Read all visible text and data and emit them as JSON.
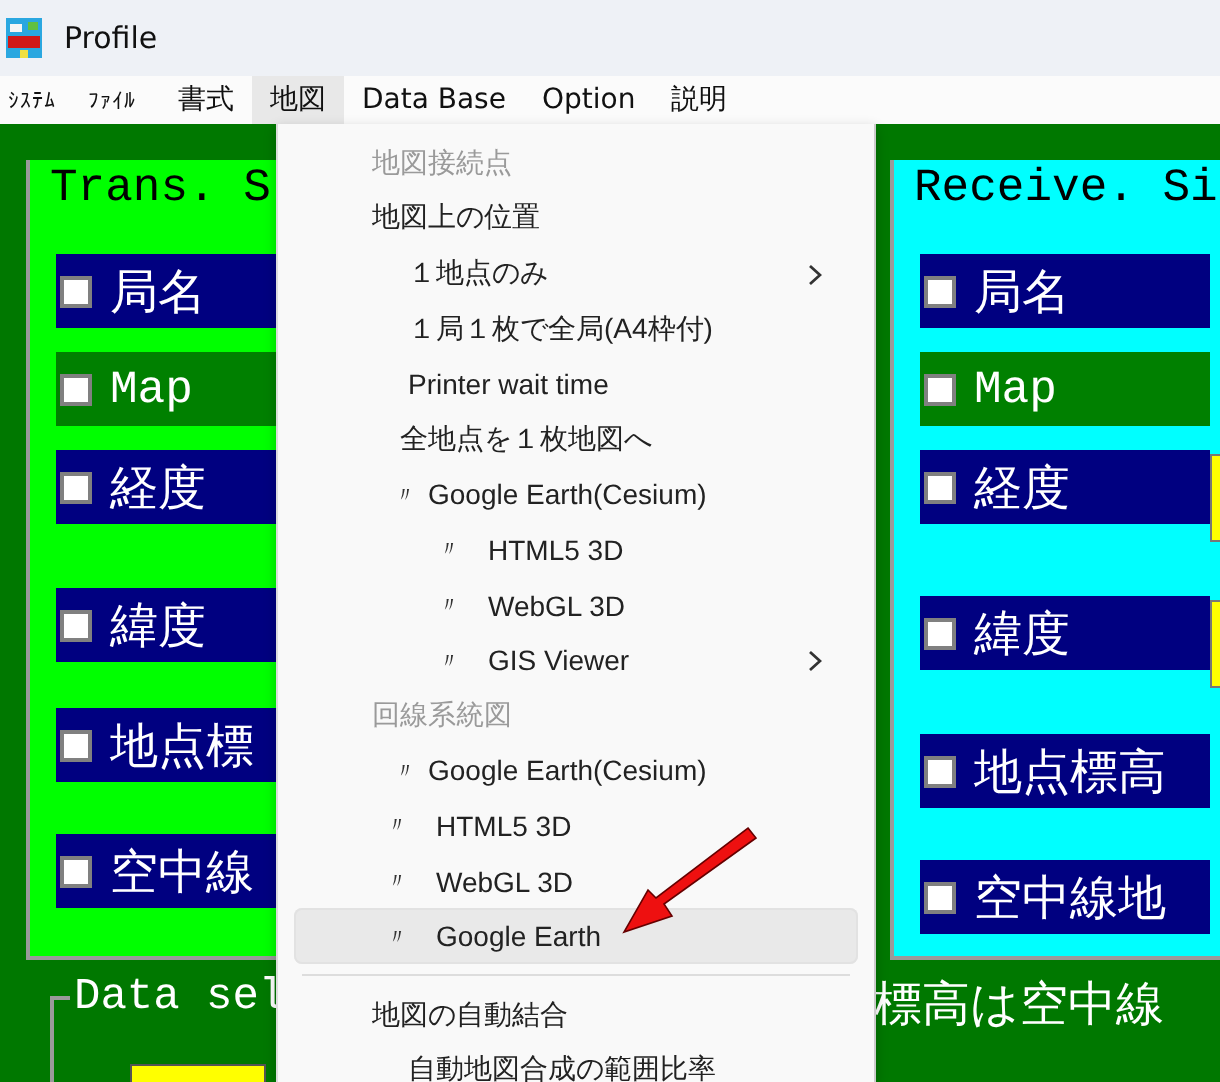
{
  "window": {
    "title": "Profile"
  },
  "menubar": [
    {
      "label": "ｼｽﾃﾑ",
      "selected": false,
      "kind": "small"
    },
    {
      "label": "ﾌｧｲﾙ",
      "selected": false,
      "kind": "small"
    },
    {
      "label": "書式",
      "selected": false,
      "kind": "normal"
    },
    {
      "label": "地図",
      "selected": true,
      "kind": "normal"
    },
    {
      "label": "Data Base",
      "selected": false,
      "kind": "normal"
    },
    {
      "label": "Option",
      "selected": false,
      "kind": "normal"
    },
    {
      "label": "説明",
      "selected": false,
      "kind": "normal"
    }
  ],
  "trans_side": {
    "title": "Trans. S",
    "strips": [
      {
        "label": "局名",
        "checked": false,
        "color": "#000080",
        "field": false
      },
      {
        "label": "Map",
        "checked": false,
        "color": "#008000",
        "field": false
      },
      {
        "label": "経度",
        "checked": false,
        "color": "#000080",
        "field": false
      },
      {
        "label": "緯度",
        "checked": false,
        "color": "#000080",
        "field": false
      },
      {
        "label": "地点標",
        "checked": false,
        "color": "#000080",
        "field": false
      },
      {
        "label": "空中線",
        "checked": false,
        "color": "#000080",
        "field": false
      }
    ]
  },
  "receive_side": {
    "title": "Receive. Si",
    "strips": [
      {
        "label": "局名",
        "checked": false,
        "color": "#000080",
        "field": false
      },
      {
        "label": "Map",
        "checked": false,
        "color": "#008000",
        "field": false
      },
      {
        "label": "経度",
        "checked": false,
        "color": "#000080",
        "field": true
      },
      {
        "label": "緯度",
        "checked": false,
        "color": "#000080",
        "field": true
      },
      {
        "label": "地点標高",
        "checked": false,
        "color": "#000080",
        "field": false
      },
      {
        "label": "空中線地",
        "checked": false,
        "color": "#000080",
        "field": false
      }
    ]
  },
  "data_select": {
    "title": "Data sel",
    "field": true
  },
  "note": "標高は空中線",
  "map_menu": [
    {
      "kind": "heading",
      "label": "地図接続点",
      "disabled": true,
      "submenu": false
    },
    {
      "kind": "item",
      "label": "地図上の位置",
      "disabled": false,
      "submenu": false,
      "selected": false
    },
    {
      "kind": "option",
      "label": "１地点のみ",
      "disabled": false,
      "submenu": true,
      "selected": false
    },
    {
      "kind": "option",
      "label": "１局１枚で全局(A4枠付)",
      "disabled": false,
      "submenu": false,
      "selected": false
    },
    {
      "kind": "option",
      "label": "Printer wait time",
      "disabled": false,
      "submenu": false,
      "selected": false
    },
    {
      "kind": "option2",
      "label": "全地点を１枚地図へ",
      "disabled": false,
      "submenu": false,
      "selected": false
    },
    {
      "kind": "link",
      "mark": "〃",
      "label": "Google Earth(Cesium)",
      "disabled": false,
      "submenu": false,
      "selected": false
    },
    {
      "kind": "sublink",
      "mark": "〃",
      "label": "HTML5 3D",
      "disabled": false,
      "submenu": false,
      "selected": false
    },
    {
      "kind": "sublink",
      "mark": "〃",
      "label": "WebGL 3D",
      "disabled": false,
      "submenu": false,
      "selected": false
    },
    {
      "kind": "sublink",
      "mark": "〃",
      "label": "GIS Viewer",
      "disabled": false,
      "submenu": true,
      "selected": false
    },
    {
      "kind": "heading",
      "label": "回線系統図",
      "disabled": true,
      "submenu": false
    },
    {
      "kind": "link",
      "mark": "〃",
      "label": "Google Earth(Cesium)",
      "disabled": false,
      "submenu": false,
      "selected": false
    },
    {
      "kind": "widelink",
      "mark": "〃",
      "label": "HTML5 3D",
      "disabled": false,
      "submenu": false,
      "selected": false
    },
    {
      "kind": "widelink",
      "mark": "〃",
      "label": "WebGL 3D",
      "disabled": false,
      "submenu": false,
      "selected": false
    },
    {
      "kind": "widelink",
      "mark": "〃",
      "label": "Google Earth",
      "disabled": false,
      "submenu": false,
      "selected": true
    },
    {
      "kind": "separator"
    },
    {
      "kind": "item",
      "label": "地図の自動結合",
      "disabled": false,
      "submenu": false,
      "selected": false
    },
    {
      "kind": "option",
      "label": "自動地図合成の範囲比率",
      "disabled": false,
      "submenu": false,
      "selected": false
    }
  ]
}
